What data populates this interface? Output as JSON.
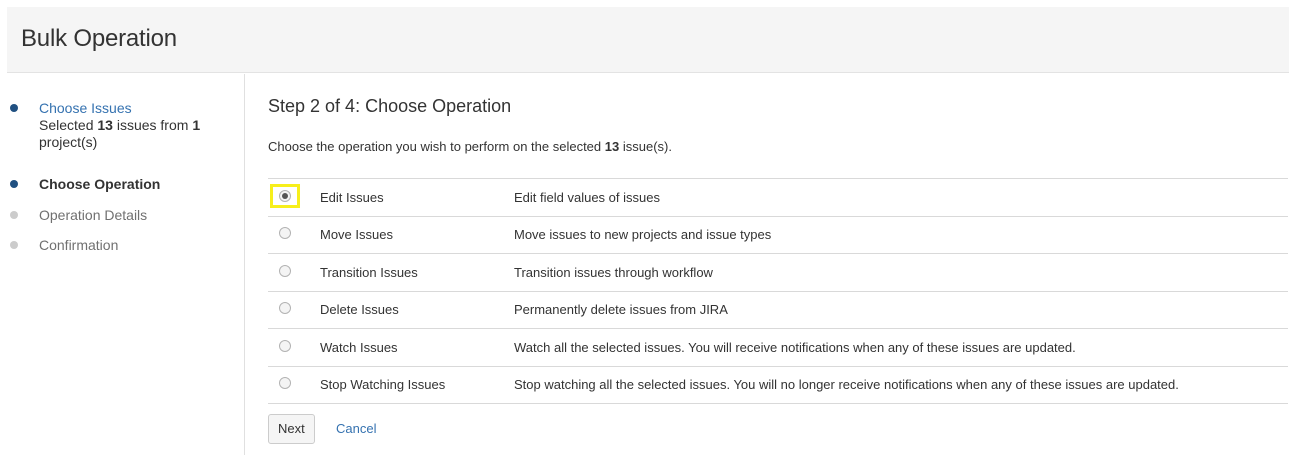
{
  "header": {
    "title": "Bulk Operation"
  },
  "sidebar": {
    "steps": [
      {
        "label": "Choose Issues",
        "state": "done",
        "desc_prefix": "Selected ",
        "desc_count": "13",
        "desc_middle": " issues from ",
        "desc_projects": "1",
        "desc_suffix": " project(s)"
      },
      {
        "label": "Choose Operation",
        "state": "current"
      },
      {
        "label": "Operation Details",
        "state": "todo"
      },
      {
        "label": "Confirmation",
        "state": "todo"
      }
    ]
  },
  "main": {
    "heading": "Step 2 of 4: Choose Operation",
    "intro_prefix": "Choose the operation you wish to perform on the selected ",
    "intro_count": "13",
    "intro_suffix": " issue(s).",
    "operations": [
      {
        "name": "Edit Issues",
        "desc": "Edit field values of issues",
        "selected": true
      },
      {
        "name": "Move Issues",
        "desc": "Move issues to new projects and issue types",
        "selected": false
      },
      {
        "name": "Transition Issues",
        "desc": "Transition issues through workflow",
        "selected": false
      },
      {
        "name": "Delete Issues",
        "desc": "Permanently delete issues from JIRA",
        "selected": false
      },
      {
        "name": "Watch Issues",
        "desc": "Watch all the selected issues. You will receive notifications when any of these issues are updated.",
        "selected": false
      },
      {
        "name": "Stop Watching Issues",
        "desc": "Stop watching all the selected issues. You will no longer receive notifications when any of these issues are updated.",
        "selected": false
      }
    ],
    "next_label": "Next",
    "cancel_label": "Cancel"
  },
  "colors": {
    "accent": "#3572b0",
    "step_dot": "#205081",
    "highlight": "#f7ef1b"
  }
}
